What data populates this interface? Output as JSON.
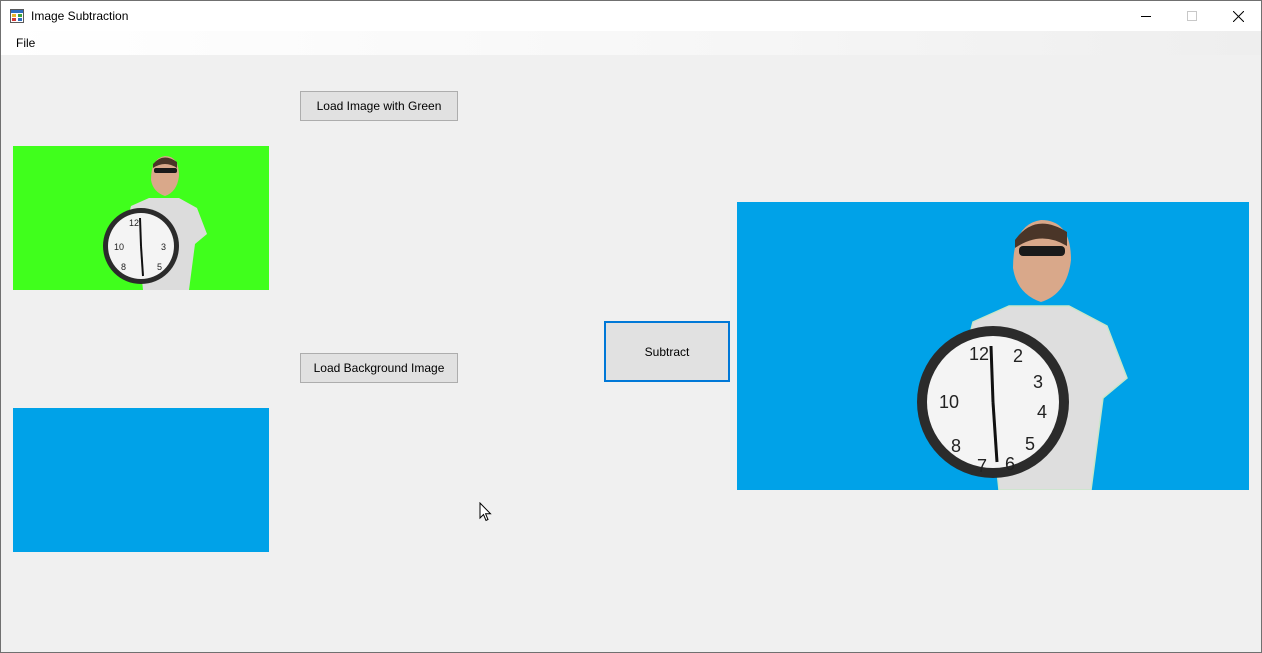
{
  "window": {
    "title": "Image Subtraction",
    "icons": {
      "app": "app-window-icon",
      "minimize": "minimize-icon",
      "maximize": "maximize-icon",
      "close": "close-icon"
    }
  },
  "menu": {
    "file_label": "File"
  },
  "buttons": {
    "load_green_label": "Load Image with Green",
    "load_background_label": "Load Background Image",
    "subtract_label": "Subtract"
  },
  "images": {
    "green_screen_color": "#40ff1c",
    "background_color": "#00a2e8",
    "result_background_color": "#00a2e8"
  },
  "colors": {
    "window_bg": "#f0f0f0",
    "button_bg": "#e1e1e1",
    "button_border": "#adadad",
    "focus_border": "#0078d7"
  }
}
